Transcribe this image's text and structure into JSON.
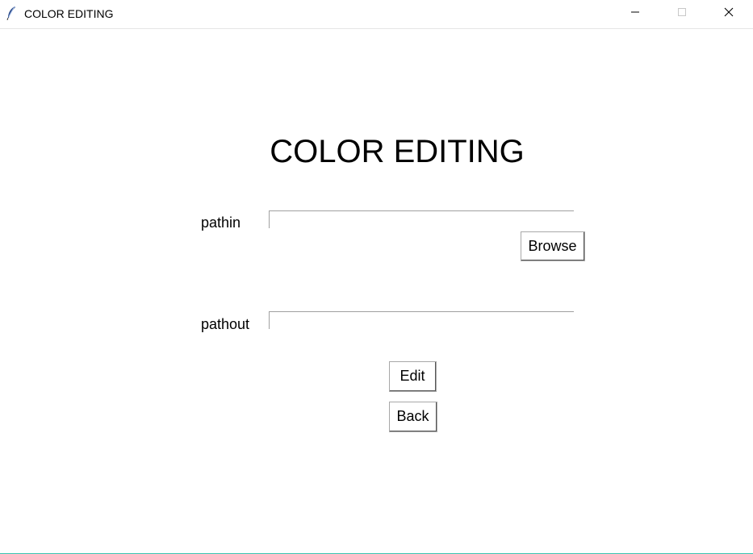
{
  "window": {
    "title": "COLOR EDITING",
    "app_icon": "feather-icon",
    "controls": {
      "minimize_icon": "minimize-icon",
      "maximize_icon": "maximize-icon",
      "close_icon": "close-icon"
    }
  },
  "main": {
    "heading": "COLOR EDITING",
    "pathin": {
      "label": "pathin",
      "value": ""
    },
    "browse_label": "Browse",
    "pathout": {
      "label": "pathout",
      "value": ""
    },
    "edit_label": "Edit",
    "back_label": "Back"
  },
  "colors": {
    "background": "#ffffff",
    "text": "#000000",
    "bottom_border_accent": "#3bc3b0"
  }
}
